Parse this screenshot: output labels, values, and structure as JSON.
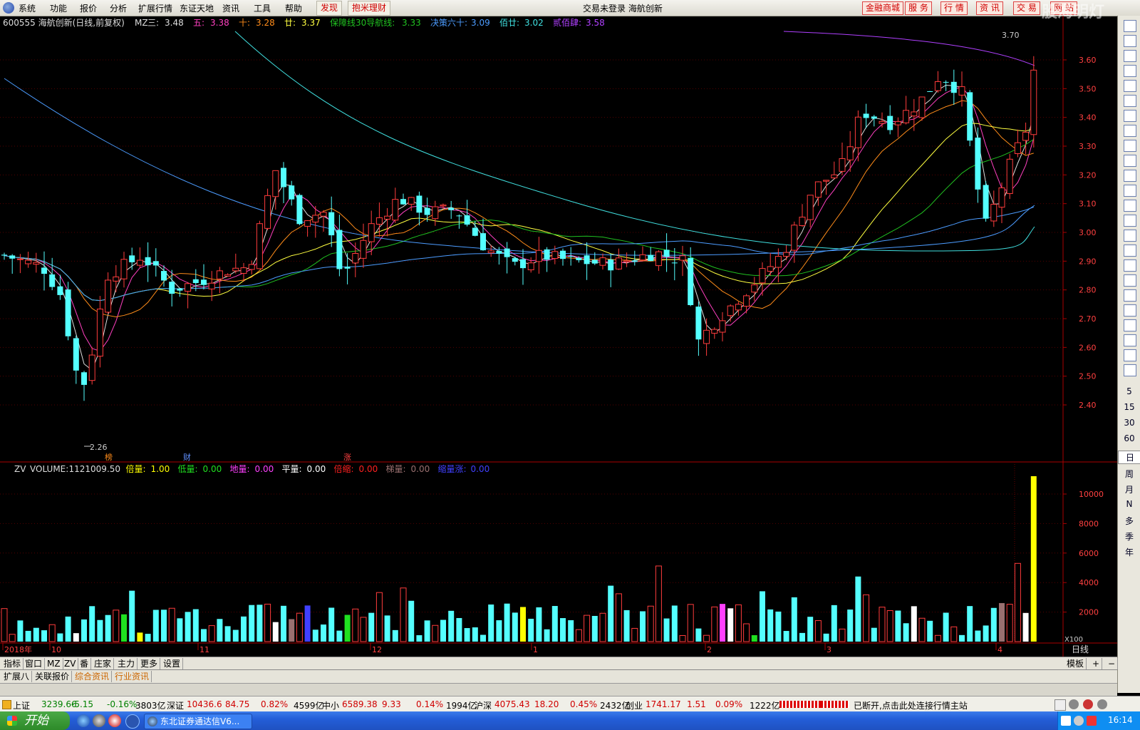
{
  "menubar": {
    "items": [
      "系统",
      "功能",
      "报价",
      "分析",
      "扩展行情",
      "东证天地",
      "资讯",
      "工具",
      "帮助"
    ],
    "red_items": [
      "发现",
      "抱米理财"
    ],
    "title": "交易未登录  海航创新",
    "right_buttons": [
      "金融商城",
      "服 务",
      "行 情",
      "资 讯",
      "交 易",
      "网 站"
    ]
  },
  "watermark": "股海明灯",
  "chart_header": {
    "code": "600555 海航创新(日线,前复权)",
    "indicator": "MZ",
    "ma": [
      {
        "label": "三:",
        "value": "3.48",
        "color": "#dddddd"
      },
      {
        "label": "五:",
        "value": "3.38",
        "color": "#ff40c0"
      },
      {
        "label": "十:",
        "value": "3.28",
        "color": "#ff8c1a"
      },
      {
        "label": "廿:",
        "value": "3.37",
        "color": "#ffff40"
      },
      {
        "label": "保障线30导航线:",
        "value": "3.33",
        "color": "#20c020"
      },
      {
        "label": "决策六十:",
        "value": "3.09",
        "color": "#4c9cff"
      },
      {
        "label": "佰廿:",
        "value": "3.02",
        "color": "#40e0e0"
      },
      {
        "label": "贰佰肆:",
        "value": "3.58",
        "color": "#b040ff"
      }
    ]
  },
  "price_axis": [
    "3.60",
    "3.50",
    "3.40",
    "3.30",
    "3.20",
    "3.10",
    "3.00",
    "2.90",
    "2.80",
    "2.70",
    "2.60",
    "2.50",
    "2.40"
  ],
  "price_markers": {
    "high": "3.70",
    "low": "2.26"
  },
  "event_tags": [
    {
      "text": "榜",
      "color": "#ff8c1a"
    },
    {
      "text": "财",
      "color": "#6090ff"
    },
    {
      "text": "涨",
      "color": "#ff4040"
    }
  ],
  "volume_header": {
    "indicator": "ZV",
    "items": [
      {
        "label": "VOLUME:",
        "value": "1121009.50",
        "color": "#dddddd"
      },
      {
        "label": "倍量:",
        "value": "1.00",
        "color": "#ffff00"
      },
      {
        "label": "低量:",
        "value": "0.00",
        "color": "#20e020"
      },
      {
        "label": "地量:",
        "value": "0.00",
        "color": "#ff40ff"
      },
      {
        "label": "平量:",
        "value": "0.00",
        "color": "#ffffff"
      },
      {
        "label": "倍缩:",
        "value": "0.00",
        "color": "#ff2020"
      },
      {
        "label": "梯量:",
        "value": "0.00",
        "color": "#9a7070"
      },
      {
        "label": "缩量涨:",
        "value": "0.00",
        "color": "#4040ff"
      }
    ]
  },
  "volume_axis": [
    "10000",
    "8000",
    "6000",
    "4000",
    "2000"
  ],
  "volume_unit": "X100",
  "date_axis": [
    "2018年",
    "10",
    "11",
    "12",
    "1",
    "2",
    "3",
    "4"
  ],
  "period": "日线",
  "tabs_row1": [
    "指标",
    "窗口",
    "MZ",
    "ZV",
    "番",
    "庄家",
    "主力",
    "更多",
    "设置"
  ],
  "tabs_row1_right": [
    "模板",
    "+",
    "−"
  ],
  "tabs_row2": [
    "扩展八",
    "关联报价",
    "综合资讯",
    "行业资讯"
  ],
  "sidebar_text": [
    "5",
    "15",
    "30",
    "60",
    "日",
    "周",
    "月",
    "N",
    "多",
    "季",
    "年"
  ],
  "statusbar": {
    "items": [
      {
        "name": "上证",
        "value": "3239.66",
        "chg": "-5.15",
        "pct": "-0.16%",
        "amt": "3803亿",
        "color": "#008000"
      },
      {
        "name": "深证",
        "value": "10436.6",
        "chg": "84.75",
        "pct": "0.82%",
        "amt": "4599亿",
        "color": "#d00000"
      },
      {
        "name": "中小",
        "value": "6589.38",
        "chg": "9.33",
        "pct": "0.14%",
        "amt": "1994亿",
        "color": "#d00000"
      },
      {
        "name": "沪深",
        "value": "4075.43",
        "chg": "18.20",
        "pct": "0.45%",
        "amt": "2432亿",
        "color": "#d00000"
      },
      {
        "name": "创业",
        "value": "1741.17",
        "chg": "1.51",
        "pct": "0.09%",
        "amt": "1222亿",
        "color": "#d00000"
      }
    ],
    "message": "已断开,点击此处连接行情主站"
  },
  "taskbar": {
    "start": "开始",
    "task": "东北证券通达信V6...",
    "clock": "16:14"
  },
  "chart_data": {
    "type": "candlestick",
    "period": "日线",
    "y_range": [
      2.26,
      3.7
    ],
    "last_close_ma": {
      "三": 3.48,
      "五": 3.38,
      "十": 3.28,
      "廿": 3.37,
      "保障线30导航线": 3.33,
      "决策六十": 3.09,
      "佰廿": 3.02,
      "贰佰肆": 3.58
    },
    "last_volume": 1121009.5,
    "volume_axis_max": 10000
  }
}
